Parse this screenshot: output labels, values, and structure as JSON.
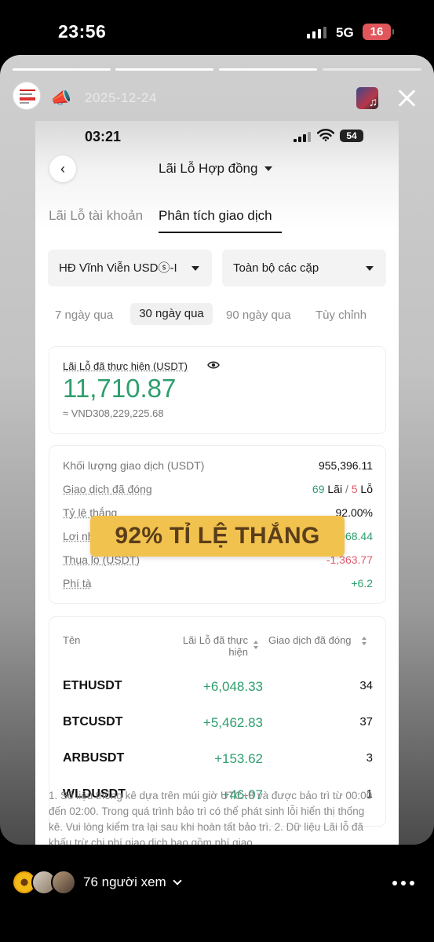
{
  "outer_status": {
    "time": "23:56",
    "network": "5G",
    "battery": "16"
  },
  "story": {
    "date": "2025-12-24",
    "progress_segments": 4,
    "viewers": "76 người xem"
  },
  "inner_status": {
    "time": "03:21",
    "battery": "54"
  },
  "nav": {
    "title": "Lãi Lỗ Hợp đồng"
  },
  "tabs": [
    {
      "label": "Lãi Lỗ tài khoản",
      "active": false
    },
    {
      "label": "Phân tích giao dịch",
      "active": true
    }
  ],
  "filters": {
    "contract": "HĐ Vĩnh Viễn USDⓢ-I",
    "pairs": "Toàn bộ các cặp"
  },
  "ranges": [
    {
      "label": "7 ngày qua",
      "active": false
    },
    {
      "label": "30 ngày qua",
      "active": true
    },
    {
      "label": "90 ngày qua",
      "active": false
    },
    {
      "label": "Tùy chỉnh",
      "active": false
    }
  ],
  "realized": {
    "label": "Lãi Lỗ đã thực hiện (USDT)",
    "value": "11,710.87",
    "vnd": "≈ VND308,229,225.68"
  },
  "stats": {
    "volume_label": "Khối lượng giao dịch (USDT)",
    "volume_value": "955,396.11",
    "closed_label": "Giao dịch đã đóng",
    "closed_wins": "69",
    "closed_wins_word": "Lãi",
    "closed_sep": "/",
    "closed_losses": "5",
    "closed_losses_word": "Lỗ",
    "winrate_label": "Tỷ lệ thắng",
    "winrate_value": "92.00%",
    "profit_label": "Lợi nhuận (USDT)",
    "profit_value": "+13,068.44",
    "loss_label": "Thua lỗ (USDT)",
    "loss_value": "-1,363.77",
    "fee_label": "Phí tà",
    "fee_value": "+6.2"
  },
  "table": {
    "col_name": "Tên",
    "col_pnl": "Lãi Lỗ đã thực hiện",
    "col_trades": "Giao dịch đã đóng",
    "rows": [
      {
        "name": "ETHUSDT",
        "pnl": "+6,048.33",
        "trades": "34"
      },
      {
        "name": "BTCUSDT",
        "pnl": "+5,462.83",
        "trades": "37"
      },
      {
        "name": "ARBUSDT",
        "pnl": "+153.62",
        "trades": "3"
      },
      {
        "name": "WLDUSDT",
        "pnl": "+46.07",
        "trades": "1"
      }
    ]
  },
  "note": "1. Số liệu thống kê dựa trên múi giờ UTC+8 và được bảo trì từ 00:00 đến 02:00. Trong quá trình bảo trì có thể phát sinh lỗi hiển thị thống kê. Vui lòng kiểm tra lại sau khi hoàn tất bảo trì. 2. Dữ liệu Lãi lỗ đã khấu trừ chi phí giao dịch bao gồm phí giao",
  "banner": "92% TỈ LỆ THẮNG",
  "colors": {
    "profit": "#2e9e6e",
    "loss": "#e0596a",
    "banner": "#f2c24e"
  },
  "icons": [
    "megaphone-icon",
    "music-note-icon",
    "close-icon",
    "back-icon",
    "eye-icon",
    "sort-icon",
    "chevron-down-icon",
    "more-icon"
  ]
}
